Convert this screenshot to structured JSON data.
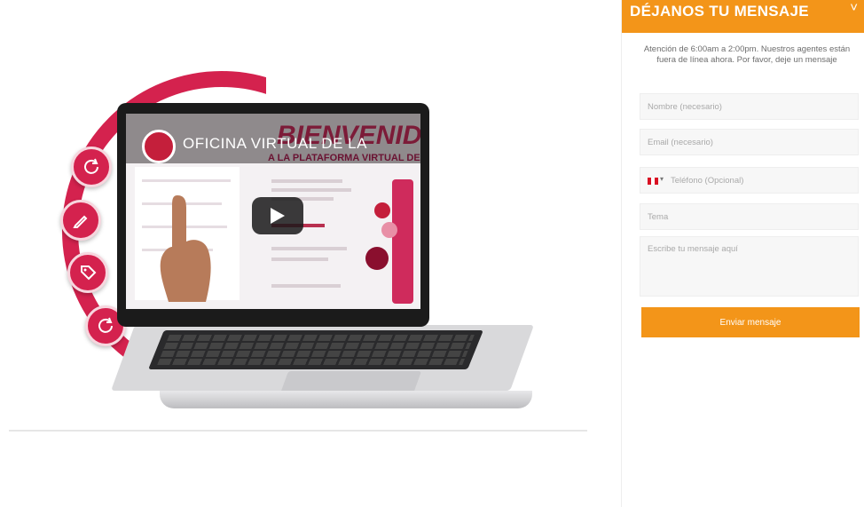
{
  "video": {
    "screen_title": "OFICINA VIRTUAL DE LA",
    "screen_big": "BIENVENIDOS",
    "screen_subtitle": "A LA PLATAFORMA VIRTUAL DE",
    "play_icon": "play-icon"
  },
  "side_buttons": [
    {
      "icon": "refresh-icon"
    },
    {
      "icon": "edit-icon"
    },
    {
      "icon": "tag-icon"
    },
    {
      "icon": "refresh-icon"
    }
  ],
  "chat": {
    "title": "DÉJANOS TU MENSAJE",
    "chevron": "˅",
    "notice": "Atención de 6:00am a 2:00pm. Nuestros agentes están fuera de línea ahora. Por favor, deje un mensaje",
    "fields": {
      "name_placeholder": "Nombre (necesario)",
      "email_placeholder": "Email (necesario)",
      "phone_placeholder": "Teléfono (Opcional)",
      "subject_placeholder": "Tema",
      "message_placeholder": "Escribe tu mensaje aquí"
    },
    "send_label": "Enviar mensaje"
  },
  "colors": {
    "accent_orange": "#f39519",
    "brand_red": "#d4224e"
  }
}
